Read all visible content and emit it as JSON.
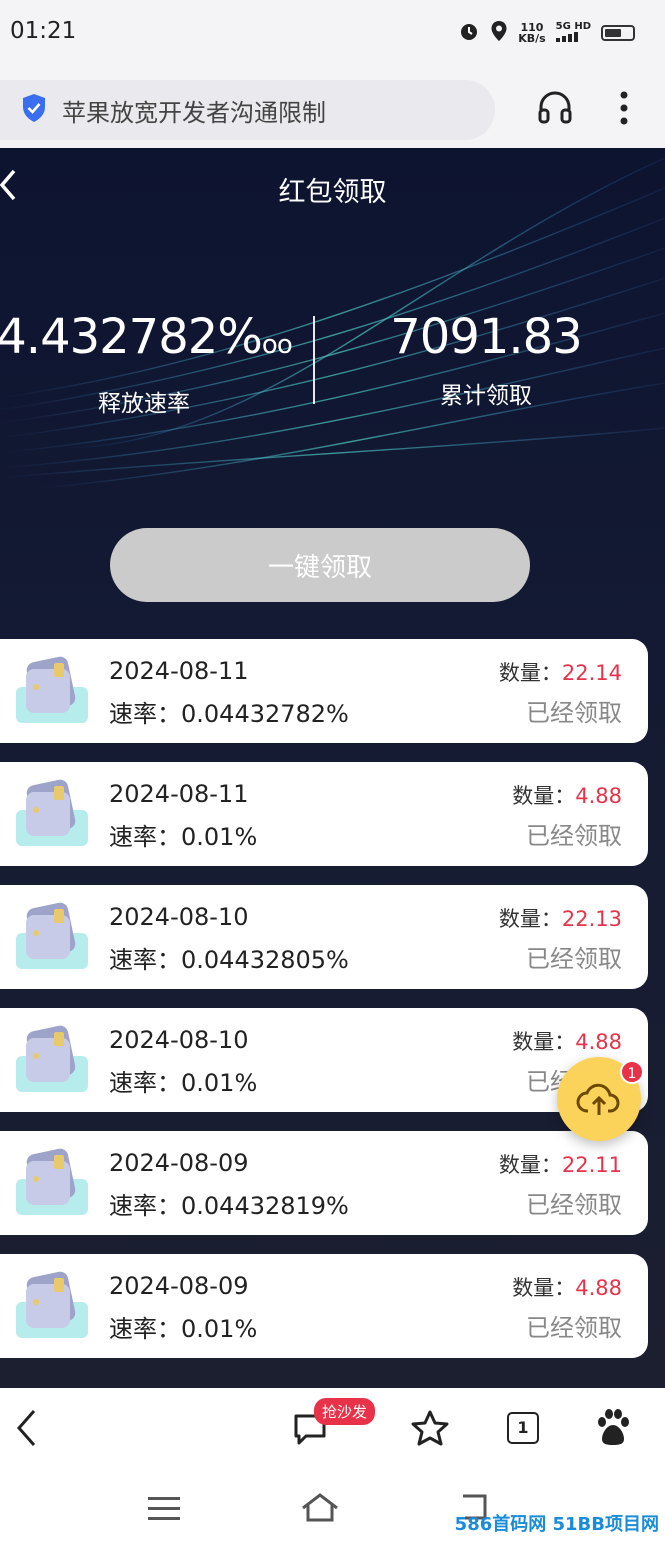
{
  "status_bar": {
    "time": "01:21",
    "speed_value": "110",
    "speed_unit": "KB/s",
    "network": "5G HD"
  },
  "browser": {
    "address_text": "苹果放宽开发者沟通限制"
  },
  "page": {
    "title": "红包领取"
  },
  "stats": {
    "release_rate_value": "4.432782%",
    "release_rate_suffix": "oo",
    "release_rate_label": "释放速率",
    "total_value": "7091.83",
    "total_label": "累计领取"
  },
  "claim_button_label": "一键领取",
  "record_labels": {
    "rate_prefix": "速率：",
    "qty_prefix": "数量："
  },
  "records": [
    {
      "date": "2024-08-11",
      "rate": "0.04432782%",
      "qty": "22.14",
      "status": "已经领取"
    },
    {
      "date": "2024-08-11",
      "rate": "0.01%",
      "qty": "4.88",
      "status": "已经领取"
    },
    {
      "date": "2024-08-10",
      "rate": "0.04432805%",
      "qty": "22.13",
      "status": "已经领取"
    },
    {
      "date": "2024-08-10",
      "rate": "0.01%",
      "qty": "4.88",
      "status": "已经领取"
    },
    {
      "date": "2024-08-09",
      "rate": "0.04432819%",
      "qty": "22.11",
      "status": "已经领取"
    },
    {
      "date": "2024-08-09",
      "rate": "0.01%",
      "qty": "4.88",
      "status": "已经领取"
    }
  ],
  "floating": {
    "badge": "1",
    "icon": "cloud-upload-icon"
  },
  "toolbar": {
    "hot_badge": "抢沙发",
    "tab_count": "1"
  },
  "watermark": "586首码网 51BB项目网"
}
